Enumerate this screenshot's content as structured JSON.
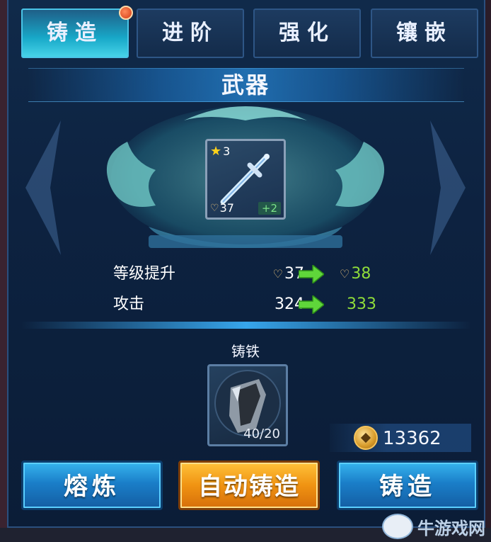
{
  "tabs": [
    {
      "label": "铸造",
      "active": true,
      "has_notification": true
    },
    {
      "label": "进阶",
      "active": false
    },
    {
      "label": "强化",
      "active": false
    },
    {
      "label": "镶嵌",
      "active": false
    }
  ],
  "panel": {
    "title": "武器"
  },
  "item": {
    "icon": "sword-icon",
    "stars": "3",
    "level": "37",
    "enhance": "+2"
  },
  "stats": [
    {
      "label": "等级提升",
      "current": "37",
      "next": "38",
      "show_heart": true
    },
    {
      "label": "攻击",
      "current": "324",
      "next": "333",
      "show_heart": false
    }
  ],
  "material": {
    "label": "铸铁",
    "icon": "iron-ore-icon",
    "count": "40/20"
  },
  "currency": {
    "icon": "coin-icon",
    "value": "13362"
  },
  "buttons": {
    "smelt": "熔炼",
    "auto_forge": "自动铸造",
    "forge": "铸造"
  },
  "watermark": {
    "text": "牛游戏网"
  },
  "colors": {
    "accent_cyan": "#18a8c8",
    "stat_green": "#8fdc3a",
    "button_blue": "#1a7ec8",
    "button_orange": "#f09312"
  }
}
